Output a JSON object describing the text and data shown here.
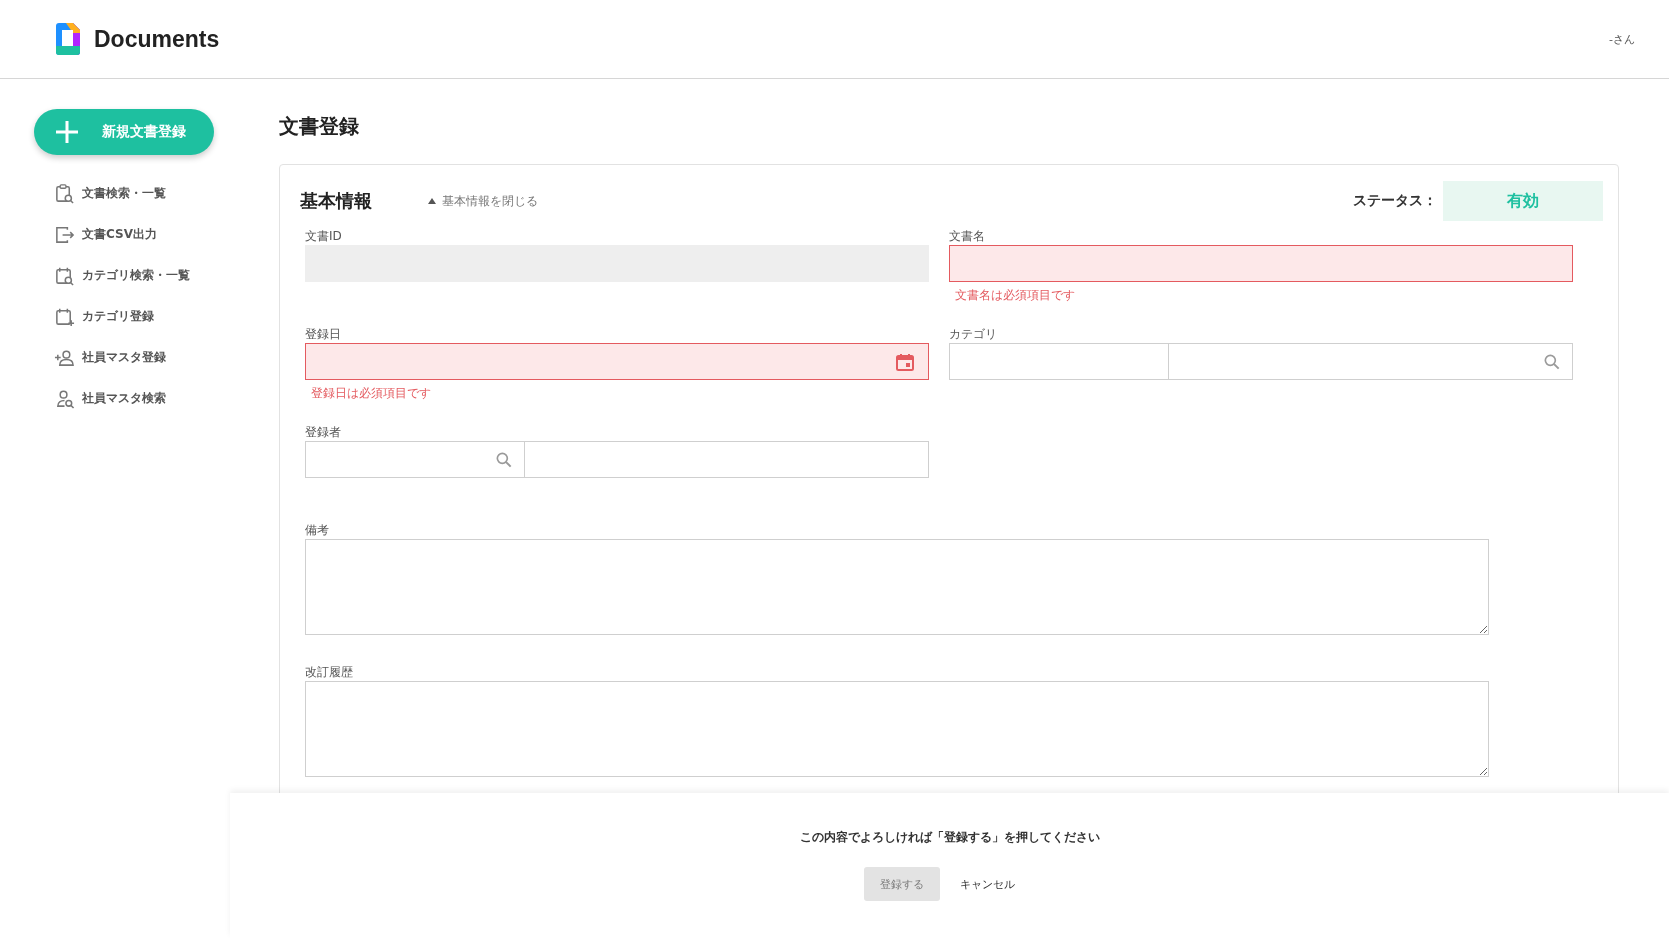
{
  "header": {
    "app_name": "Documents",
    "user": "-さん"
  },
  "sidebar": {
    "new_button": "新規文書登録",
    "items": [
      {
        "label": "文書検索・一覧",
        "kind": "clipboard-search"
      },
      {
        "label": "文書CSV出力",
        "kind": "export"
      },
      {
        "label": "カテゴリ検索・一覧",
        "kind": "calendar-search"
      },
      {
        "label": "カテゴリ登録",
        "kind": "calendar-add"
      },
      {
        "label": "社員マスタ登録",
        "kind": "person-add"
      },
      {
        "label": "社員マスタ検索",
        "kind": "person-search"
      }
    ]
  },
  "page_title": "文書登録",
  "section": {
    "title": "基本情報",
    "toggle": "基本情報を閉じる",
    "expanded": true,
    "status_label": "ステータス：",
    "status_value": "有効"
  },
  "fields": [
    {
      "label": "文書ID",
      "kind": "text",
      "disabled": true
    },
    {
      "label": "文書名",
      "kind": "text",
      "disabled": false,
      "error": "文書名は必須項目です"
    },
    {
      "label": "登録日",
      "kind": "date",
      "disabled": false,
      "error": "登録日は必須項目です"
    },
    {
      "label": "カテゴリ",
      "kind": "lookup",
      "disabled": false
    },
    {
      "label": "登録者",
      "kind": "picker",
      "disabled": false
    },
    {
      "label": "備考",
      "kind": "textarea",
      "disabled": false
    },
    {
      "label": "改訂履歴",
      "kind": "textarea",
      "disabled": false
    }
  ],
  "footer": {
    "message": "この内容でよろしければ「登録する」を押してください",
    "submit": {
      "label": "登録する",
      "disabled": true
    },
    "cancel": "キャンセル"
  }
}
